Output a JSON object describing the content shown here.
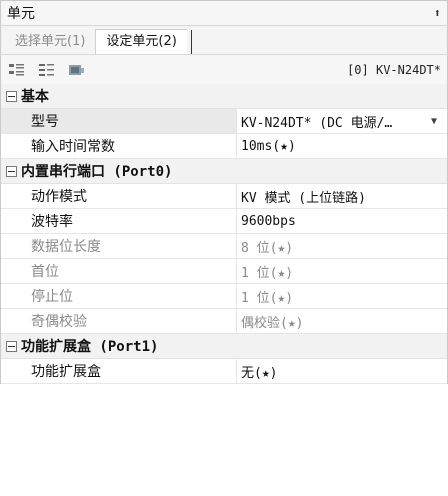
{
  "panel": {
    "title": "单元",
    "pin_icon": "pin-icon"
  },
  "tabs": [
    {
      "label": "选择单元(1)"
    },
    {
      "label": "设定单元(2)"
    }
  ],
  "toolbar": {
    "icons": [
      "categorize-icon",
      "sort-icon",
      "property-pages-icon"
    ],
    "device": "[0] KV-N24DT*"
  },
  "groups": [
    {
      "label": "基本",
      "rows": [
        {
          "label": "型号",
          "value": "KV-N24DT* (DC 电源/…",
          "selected": true
        },
        {
          "label": "输入时间常数",
          "value": "10ms(★)"
        }
      ]
    },
    {
      "label": "内置串行端口 (Port0)",
      "rows": [
        {
          "label": "动作模式",
          "value": "KV 模式 (上位链路)"
        },
        {
          "label": "波特率",
          "value": "9600bps"
        },
        {
          "label": "数据位长度",
          "value": "8 位(★)",
          "dim": true
        },
        {
          "label": "首位",
          "value": "1 位(★)",
          "dim": true
        },
        {
          "label": "停止位",
          "value": "1 位(★)",
          "dim": true
        },
        {
          "label": "奇偶校验",
          "value": "偶校验(★)",
          "dim": true
        }
      ]
    },
    {
      "label": "功能扩展盒 (Port1)",
      "rows": [
        {
          "label": "功能扩展盒",
          "value": "无(★)"
        }
      ]
    }
  ]
}
